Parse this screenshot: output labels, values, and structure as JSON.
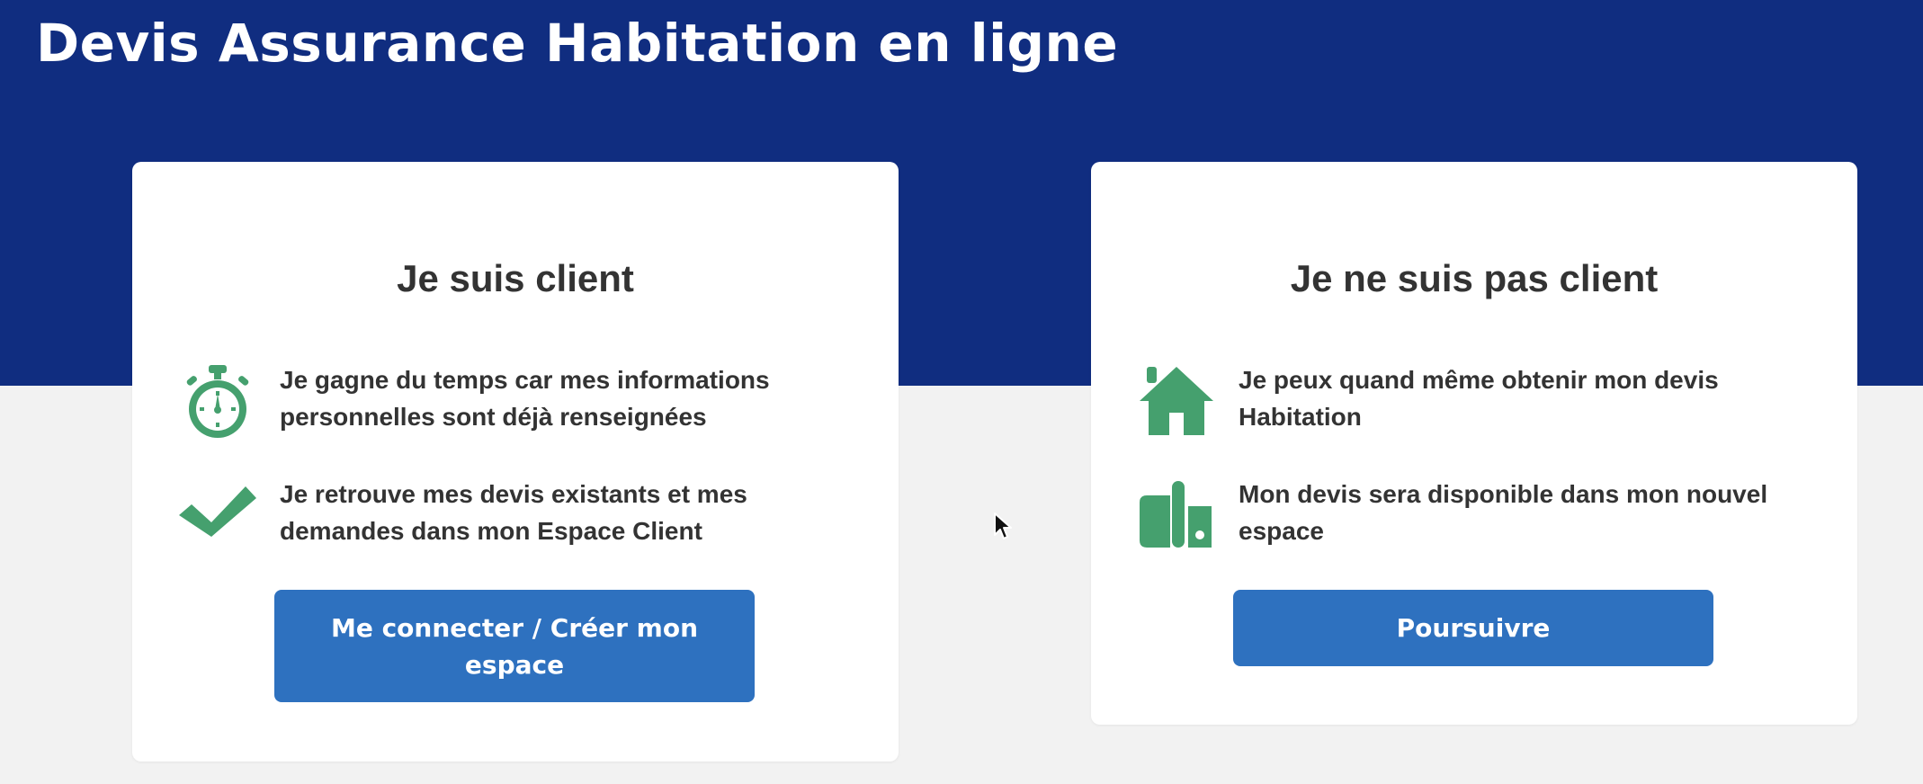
{
  "page": {
    "title": "Devis Assurance Habitation en ligne"
  },
  "colors": {
    "hero_background": "#102d80",
    "page_background": "#f2f2f2",
    "card_background": "#ffffff",
    "icon_green": "#45a06e",
    "button_blue": "#2e71bf",
    "text_dark": "#333333"
  },
  "client_card": {
    "title": "Je suis client",
    "features": [
      {
        "icon": "stopwatch-icon",
        "text": "Je gagne du temps car mes informations personnelles sont déjà renseignées"
      },
      {
        "icon": "checkmark-icon",
        "text": "Je retrouve mes devis existants et mes demandes dans mon Espace Client"
      }
    ],
    "button_label": "Me connecter / Créer mon espace"
  },
  "prospect_card": {
    "title": "Je ne suis pas client",
    "features": [
      {
        "icon": "house-icon",
        "text": "Je peux quand même obtenir mon devis Habitation"
      },
      {
        "icon": "documents-icon",
        "text": "Mon devis sera disponible dans mon nouvel espace"
      }
    ],
    "button_label": "Poursuivre"
  }
}
